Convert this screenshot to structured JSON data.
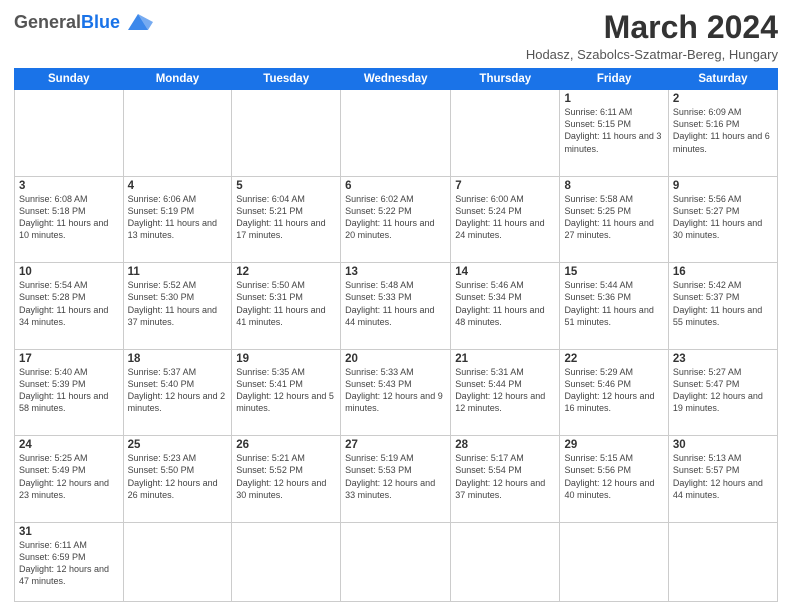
{
  "header": {
    "logo_general": "General",
    "logo_blue": "Blue",
    "title": "March 2024",
    "location": "Hodasz, Szabolcs-Szatmar-Bereg, Hungary"
  },
  "days_of_week": [
    "Sunday",
    "Monday",
    "Tuesday",
    "Wednesday",
    "Thursday",
    "Friday",
    "Saturday"
  ],
  "weeks": [
    [
      {
        "num": "",
        "info": ""
      },
      {
        "num": "",
        "info": ""
      },
      {
        "num": "",
        "info": ""
      },
      {
        "num": "",
        "info": ""
      },
      {
        "num": "",
        "info": ""
      },
      {
        "num": "1",
        "info": "Sunrise: 6:11 AM\nSunset: 5:15 PM\nDaylight: 11 hours\nand 3 minutes."
      },
      {
        "num": "2",
        "info": "Sunrise: 6:09 AM\nSunset: 5:16 PM\nDaylight: 11 hours\nand 6 minutes."
      }
    ],
    [
      {
        "num": "3",
        "info": "Sunrise: 6:08 AM\nSunset: 5:18 PM\nDaylight: 11 hours\nand 10 minutes."
      },
      {
        "num": "4",
        "info": "Sunrise: 6:06 AM\nSunset: 5:19 PM\nDaylight: 11 hours\nand 13 minutes."
      },
      {
        "num": "5",
        "info": "Sunrise: 6:04 AM\nSunset: 5:21 PM\nDaylight: 11 hours\nand 17 minutes."
      },
      {
        "num": "6",
        "info": "Sunrise: 6:02 AM\nSunset: 5:22 PM\nDaylight: 11 hours\nand 20 minutes."
      },
      {
        "num": "7",
        "info": "Sunrise: 6:00 AM\nSunset: 5:24 PM\nDaylight: 11 hours\nand 24 minutes."
      },
      {
        "num": "8",
        "info": "Sunrise: 5:58 AM\nSunset: 5:25 PM\nDaylight: 11 hours\nand 27 minutes."
      },
      {
        "num": "9",
        "info": "Sunrise: 5:56 AM\nSunset: 5:27 PM\nDaylight: 11 hours\nand 30 minutes."
      }
    ],
    [
      {
        "num": "10",
        "info": "Sunrise: 5:54 AM\nSunset: 5:28 PM\nDaylight: 11 hours\nand 34 minutes."
      },
      {
        "num": "11",
        "info": "Sunrise: 5:52 AM\nSunset: 5:30 PM\nDaylight: 11 hours\nand 37 minutes."
      },
      {
        "num": "12",
        "info": "Sunrise: 5:50 AM\nSunset: 5:31 PM\nDaylight: 11 hours\nand 41 minutes."
      },
      {
        "num": "13",
        "info": "Sunrise: 5:48 AM\nSunset: 5:33 PM\nDaylight: 11 hours\nand 44 minutes."
      },
      {
        "num": "14",
        "info": "Sunrise: 5:46 AM\nSunset: 5:34 PM\nDaylight: 11 hours\nand 48 minutes."
      },
      {
        "num": "15",
        "info": "Sunrise: 5:44 AM\nSunset: 5:36 PM\nDaylight: 11 hours\nand 51 minutes."
      },
      {
        "num": "16",
        "info": "Sunrise: 5:42 AM\nSunset: 5:37 PM\nDaylight: 11 hours\nand 55 minutes."
      }
    ],
    [
      {
        "num": "17",
        "info": "Sunrise: 5:40 AM\nSunset: 5:39 PM\nDaylight: 11 hours\nand 58 minutes."
      },
      {
        "num": "18",
        "info": "Sunrise: 5:37 AM\nSunset: 5:40 PM\nDaylight: 12 hours\nand 2 minutes."
      },
      {
        "num": "19",
        "info": "Sunrise: 5:35 AM\nSunset: 5:41 PM\nDaylight: 12 hours\nand 5 minutes."
      },
      {
        "num": "20",
        "info": "Sunrise: 5:33 AM\nSunset: 5:43 PM\nDaylight: 12 hours\nand 9 minutes."
      },
      {
        "num": "21",
        "info": "Sunrise: 5:31 AM\nSunset: 5:44 PM\nDaylight: 12 hours\nand 12 minutes."
      },
      {
        "num": "22",
        "info": "Sunrise: 5:29 AM\nSunset: 5:46 PM\nDaylight: 12 hours\nand 16 minutes."
      },
      {
        "num": "23",
        "info": "Sunrise: 5:27 AM\nSunset: 5:47 PM\nDaylight: 12 hours\nand 19 minutes."
      }
    ],
    [
      {
        "num": "24",
        "info": "Sunrise: 5:25 AM\nSunset: 5:49 PM\nDaylight: 12 hours\nand 23 minutes."
      },
      {
        "num": "25",
        "info": "Sunrise: 5:23 AM\nSunset: 5:50 PM\nDaylight: 12 hours\nand 26 minutes."
      },
      {
        "num": "26",
        "info": "Sunrise: 5:21 AM\nSunset: 5:52 PM\nDaylight: 12 hours\nand 30 minutes."
      },
      {
        "num": "27",
        "info": "Sunrise: 5:19 AM\nSunset: 5:53 PM\nDaylight: 12 hours\nand 33 minutes."
      },
      {
        "num": "28",
        "info": "Sunrise: 5:17 AM\nSunset: 5:54 PM\nDaylight: 12 hours\nand 37 minutes."
      },
      {
        "num": "29",
        "info": "Sunrise: 5:15 AM\nSunset: 5:56 PM\nDaylight: 12 hours\nand 40 minutes."
      },
      {
        "num": "30",
        "info": "Sunrise: 5:13 AM\nSunset: 5:57 PM\nDaylight: 12 hours\nand 44 minutes."
      }
    ],
    [
      {
        "num": "31",
        "info": "Sunrise: 6:11 AM\nSunset: 6:59 PM\nDaylight: 12 hours\nand 47 minutes."
      },
      {
        "num": "",
        "info": ""
      },
      {
        "num": "",
        "info": ""
      },
      {
        "num": "",
        "info": ""
      },
      {
        "num": "",
        "info": ""
      },
      {
        "num": "",
        "info": ""
      },
      {
        "num": "",
        "info": ""
      }
    ]
  ]
}
